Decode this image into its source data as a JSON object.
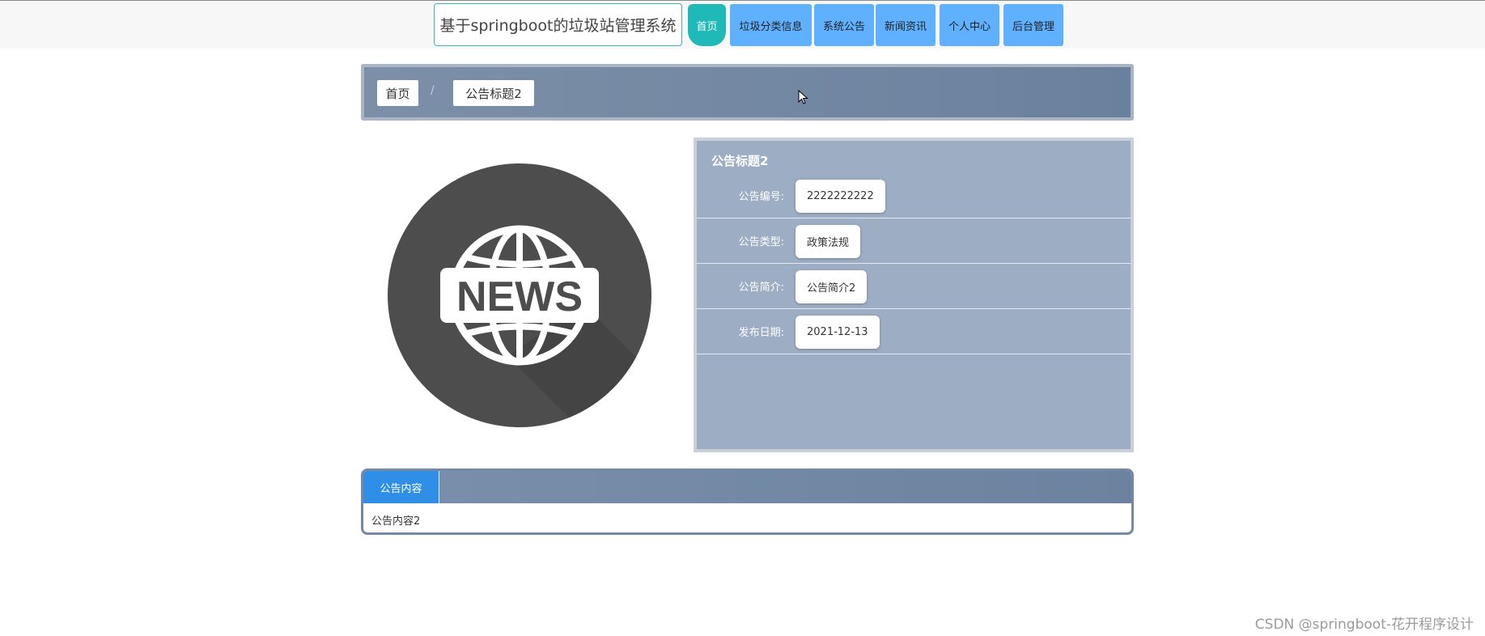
{
  "header": {
    "site_title": "基于springboot的垃圾站管理系统",
    "nav": [
      {
        "label": "首页",
        "active": true
      },
      {
        "label": "垃圾分类信息",
        "active": false
      },
      {
        "label": "系统公告",
        "active": false
      },
      {
        "label": "新闻资讯",
        "active": false
      },
      {
        "label": "个人中心",
        "active": false
      },
      {
        "label": "后台管理",
        "active": false
      }
    ]
  },
  "breadcrumb": {
    "home": "首页",
    "separator": "/",
    "current": "公告标题2"
  },
  "image": {
    "icon": "news-globe-icon",
    "text": "NEWS"
  },
  "detail": {
    "title": "公告标题2",
    "rows": [
      {
        "label": "公告编号:",
        "value": "2222222222"
      },
      {
        "label": "公告类型:",
        "value": "政策法规"
      },
      {
        "label": "公告简介:",
        "value": "公告简介2"
      },
      {
        "label": "发布日期:",
        "value": "2021-12-13"
      }
    ]
  },
  "content": {
    "tab_label": "公告内容",
    "body": "公告内容2"
  },
  "watermark": "CSDN @springboot-花开程序设计",
  "colors": {
    "nav_active": "#1fbab8",
    "nav_item": "#5fb1ff",
    "panel_bg": "#9dadc4",
    "tab_active": "#2f8fe6"
  }
}
